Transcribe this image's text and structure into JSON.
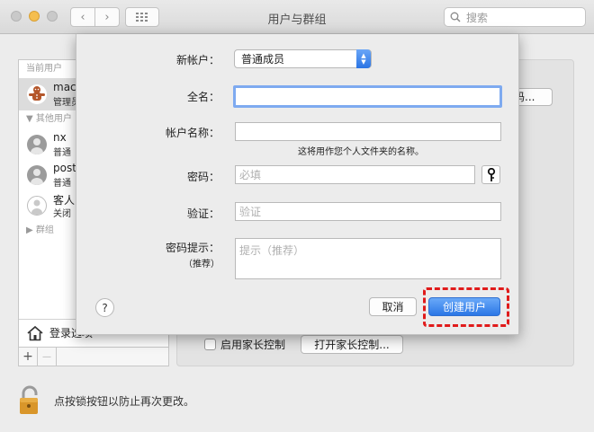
{
  "window": {
    "title": "用户与群组"
  },
  "toolbar": {
    "back_glyph": "‹",
    "forward_glyph": "›"
  },
  "search": {
    "placeholder": "搜索",
    "icon": "search-icon"
  },
  "sidebar": {
    "current_users_header": "当前用户",
    "other_users_header": "其他用户",
    "groups_header": "群组",
    "items": [
      {
        "name": "mac",
        "role": "管理员",
        "icon": "gingerbread-avatar-icon"
      },
      {
        "name": "nx",
        "role": "普通",
        "icon": "user-avatar-icon"
      },
      {
        "name": "post",
        "role": "普通",
        "icon": "user-avatar-icon"
      },
      {
        "name": "客人",
        "role": "关闭",
        "icon": "guest-avatar-icon"
      }
    ],
    "login_options": "登录选项",
    "add_glyph": "+",
    "remove_glyph": "—"
  },
  "background_panel": {
    "password_button": "码...",
    "parental_checkbox_label": "启用家长控制",
    "parental_button": "打开家长控制..."
  },
  "lock": {
    "text": "点按锁按钮以防止再次更改。",
    "icon": "padlock-icon"
  },
  "sheet": {
    "new_account_label": "新帐户：",
    "new_account_value": "普通成员",
    "full_name_label": "全名：",
    "full_name_value": "",
    "account_name_label": "帐户名称：",
    "account_name_value": "",
    "account_name_hint": "这将用作您个人文件夹的名称。",
    "password_label": "密码：",
    "password_placeholder": "必填",
    "verify_label": "验证：",
    "verify_placeholder": "验证",
    "hint_label": "密码提示：",
    "hint_sublabel": "（推荐）",
    "hint_placeholder": "提示（推荐）",
    "help_glyph": "?",
    "cancel_button": "取消",
    "create_button": "创建用户"
  },
  "colors": {
    "accent": "#2b77e6",
    "highlight_border": "#e01b1b",
    "focus_ring": "#7eaaf0"
  }
}
